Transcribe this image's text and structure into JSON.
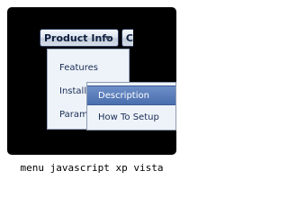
{
  "menubar": {
    "product_info": "Product Info",
    "next_item": "C"
  },
  "dropdown": {
    "items": [
      {
        "label": "Features"
      },
      {
        "label": "Installation"
      },
      {
        "label": "Parameters"
      }
    ]
  },
  "submenu": {
    "items": [
      {
        "label": "Description"
      },
      {
        "label": "How To Setup"
      }
    ]
  },
  "caption": "menu javascript xp vista",
  "colors": {
    "panel": "#000000",
    "menubar_bg": "#dfe6f0",
    "highlight": "#5a7fbe",
    "text": "#1a2d55"
  }
}
